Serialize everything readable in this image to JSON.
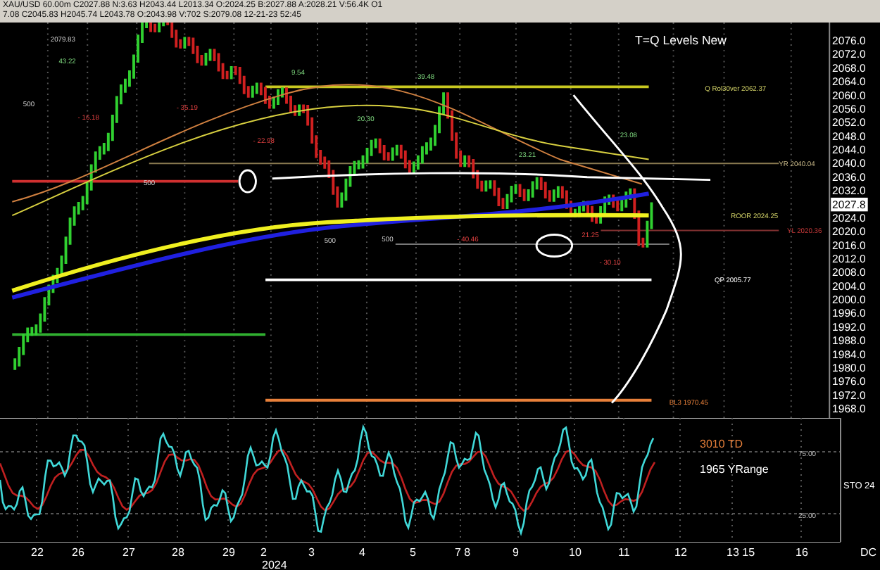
{
  "header": {
    "line_1": "XAU/USD 60.00m C2027.88 N:3.63 H2043.44 L2013.34 O:2024.25 B:2027.88 A:2028.21 V:56.4K O1",
    "line_2": "7.08 C2045.83 H2045.74 L2043.78 O:2043.98 V:702 S:2079.08 12-21-23 52:45"
  },
  "chart": {
    "title": "T=Q Levels New",
    "price_ticks": [
      "2076.0",
      "2072.0",
      "2068.0",
      "2064.0",
      "2060.0",
      "2056.0",
      "2052.0",
      "2048.0",
      "2044.0",
      "2040.0",
      "2036.0",
      "2032.0",
      "2024.0",
      "2020.0",
      "2016.0",
      "2012.0",
      "2008.0",
      "2004.0",
      "2000.0",
      "1996.0",
      "1992.0",
      "1988.0",
      "1984.0",
      "1980.0",
      "1976.0",
      "1972.0",
      "1968.0"
    ],
    "current_price": "2027.8",
    "level_labels": [
      "Q Rol30ver 2062.37",
      "YR 2040.04",
      "ROOR 2024.25",
      "YL 2020.36",
      "QP 2005.77",
      "BL3 1970.45"
    ],
    "bar_labels": [
      {
        "text": "2079.83",
        "kind": "price"
      },
      {
        "text": "43.22",
        "kind": "gain"
      },
      {
        "text": "9.54",
        "kind": "gain"
      },
      {
        "text": "39.48",
        "kind": "gain"
      },
      {
        "text": "500",
        "kind": "price"
      },
      {
        "text": "- 16.18",
        "kind": "loss"
      },
      {
        "text": "- 35.19",
        "kind": "loss"
      },
      {
        "text": "- 22.98",
        "kind": "loss"
      },
      {
        "text": "20.30",
        "kind": "gain"
      },
      {
        "text": "23.21",
        "kind": "gain"
      },
      {
        "text": "23.08",
        "kind": "gain"
      },
      {
        "text": "500",
        "kind": "price"
      },
      {
        "text": "500",
        "kind": "price"
      },
      {
        "text": "500",
        "kind": "price"
      },
      {
        "text": "- 40.46",
        "kind": "loss"
      },
      {
        "text": "21.25",
        "kind": "loss"
      },
      {
        "text": "- 30.10",
        "kind": "loss"
      }
    ]
  },
  "indicator": {
    "labels": [
      "3010 TD",
      "1965 YRange"
    ],
    "name": "STO 24",
    "ticks": [
      "75.00",
      "25.00"
    ]
  },
  "x_axis": {
    "labels": [
      "22",
      "26",
      "27",
      "28",
      "29",
      "2",
      "3",
      "4",
      "5",
      "7 8",
      "9",
      "10",
      "11",
      "12",
      "13 15",
      "16"
    ],
    "year": "2024",
    "corner": "DC"
  }
}
